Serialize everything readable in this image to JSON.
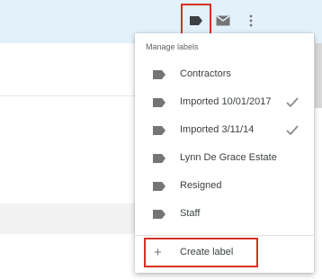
{
  "toolbar": {
    "icons": [
      "label-icon",
      "mail-icon",
      "more-vert-icon"
    ],
    "highlight_color": "#d93025"
  },
  "menu": {
    "header": "Manage labels",
    "items": [
      {
        "label": "Contractors",
        "checked": false
      },
      {
        "label": "Imported 10/01/2017",
        "checked": true
      },
      {
        "label": "Imported 3/11/14",
        "checked": true
      },
      {
        "label": "Lynn De Grace Estate",
        "checked": false
      },
      {
        "label": "Resigned",
        "checked": false
      },
      {
        "label": "Staff",
        "checked": false
      }
    ],
    "create_label": "Create label",
    "create_icon": "+"
  },
  "colors": {
    "toolbar_bg": "#e3f1fb",
    "icon": "#757575",
    "check": "#8a8a8a",
    "highlight": "#d93025"
  }
}
